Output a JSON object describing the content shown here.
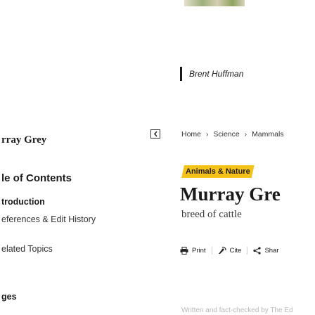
{
  "sidebar": {
    "title": "rray Grey",
    "toc_heading": "le of Contents",
    "toc_items": [
      {
        "label": "troduction"
      },
      {
        "label": "eferences & Edit History"
      }
    ],
    "related": "elated Topics",
    "images": "ges"
  },
  "article": {
    "author": "Brent Huffman",
    "breadcrumb": [
      "Home",
      "Science",
      "Mammals"
    ],
    "category": "Animals & Nature",
    "title": "Murray Gre",
    "subtitle": "breed of cattle",
    "actions": [
      {
        "label": "Print",
        "icon": "print-icon"
      },
      {
        "label": "Cite",
        "icon": "cite-icon"
      },
      {
        "label": "Shar",
        "icon": "share-icon"
      }
    ],
    "cut_text": "Written and fact-checked by The Ed"
  },
  "colors": {
    "tag_background": "#f5c21a",
    "text": "#1a1a1a"
  }
}
